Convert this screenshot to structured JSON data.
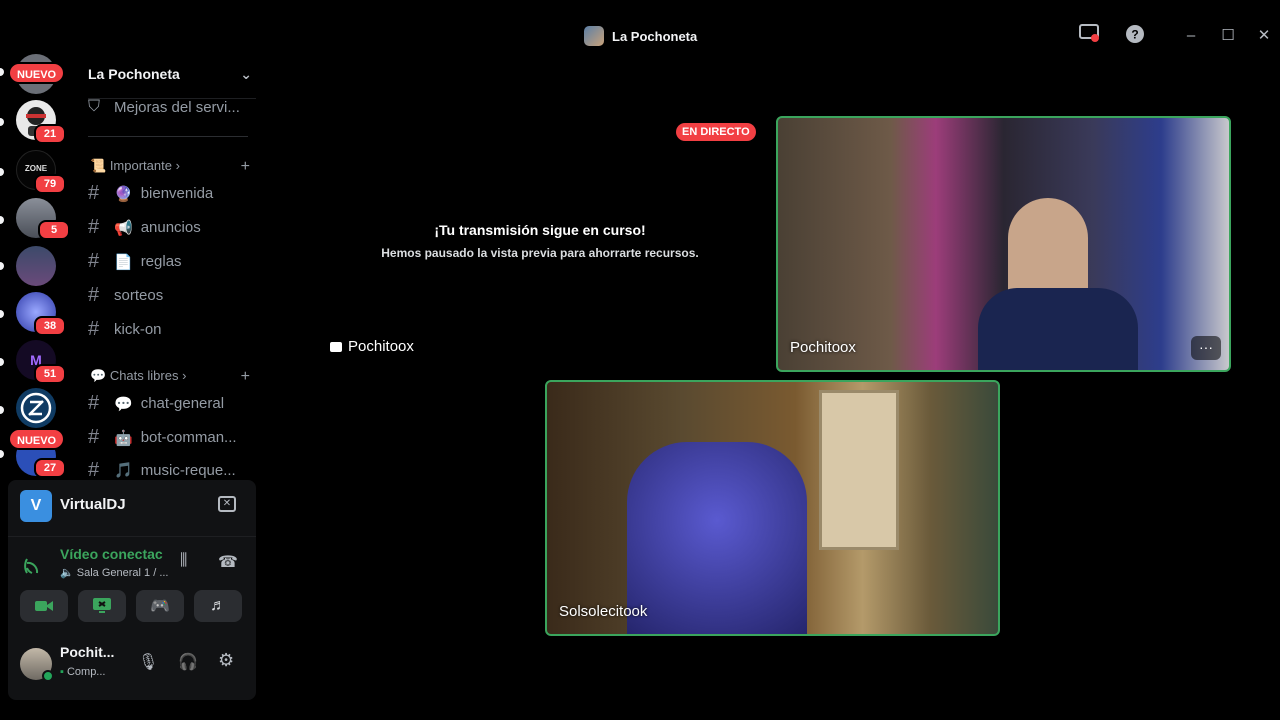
{
  "window": {
    "title": "La Pochoneta"
  },
  "guilds": {
    "badges": [
      "NUEVO",
      "21",
      "79",
      "5",
      "38",
      "51",
      "NUEVO",
      "27"
    ],
    "server_names": [
      "ZONE"
    ]
  },
  "sidebar": {
    "server_name": "La Pochoneta",
    "top_item": "Mejoras del servi...",
    "category_1": "Importante",
    "channels_1": [
      "bienvenida",
      "anuncios",
      "reglas",
      "sorteos",
      "kick-on"
    ],
    "category_2": "Chats libres",
    "channels_2": [
      "chat-general",
      "bot-comman...",
      "music-reque..."
    ]
  },
  "stream_panel": {
    "app_name": "VirtualDJ",
    "voice_status": "Vídeo conectac",
    "voice_channel": "Sala General 1 / ...",
    "user_name": "Pochit...",
    "user_status": "Comp..."
  },
  "stage": {
    "live_badge": "EN DIRECTO",
    "paused_title": "¡Tu transmisión sigue en curso!",
    "paused_subtitle": "Hemos pausado la vista previa para ahorrarte recursos.",
    "self_stream_label": "Pochitoox",
    "tiles": [
      {
        "name": "Pochitoox",
        "more": "···"
      },
      {
        "name": "Solsolecitook"
      }
    ]
  },
  "colors": {
    "accent_green": "#3ba55d",
    "badge_red": "#f23f43"
  }
}
